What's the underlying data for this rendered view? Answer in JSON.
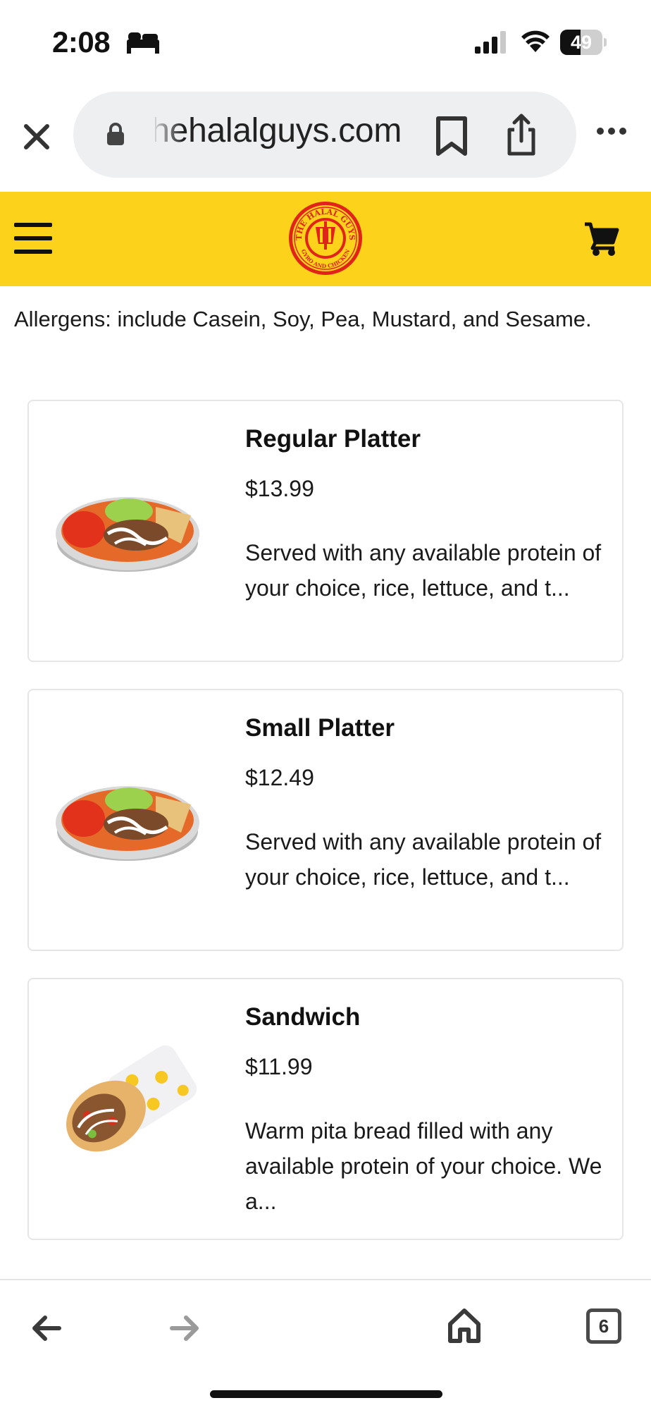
{
  "status_bar": {
    "time": "2:08",
    "battery_level": "49",
    "icons": [
      "bed-icon",
      "signal-icon",
      "wifi-icon",
      "battery-icon"
    ]
  },
  "browser": {
    "url": "thehalalguys.com",
    "icons": [
      "close-icon",
      "lock-icon",
      "bookmark-icon",
      "share-icon",
      "more-icon"
    ]
  },
  "site_header": {
    "logo_text_top": "THE HALAL GUYS",
    "logo_text_bottom": "GYRO AND CHICKEN",
    "brand_color": "#fcd21a",
    "logo_color": "#e2231a",
    "icons": [
      "hamburger-menu-icon",
      "cart-icon"
    ]
  },
  "allergens": "Allergens: include Casein, Soy, Pea, Mustard, and Sesame.",
  "menu_items": [
    {
      "name": "Regular Platter",
      "price": "$13.99",
      "description": "Served with any available protein of your choice, rice, lettuce, and t...",
      "image": "platter-image"
    },
    {
      "name": "Small Platter",
      "price": "$12.49",
      "description": "Served with any available protein of your choice, rice, lettuce, and t...",
      "image": "platter-image"
    },
    {
      "name": "Sandwich",
      "price": "$11.99",
      "description": "Warm pita bread filled with any available protein of your choice. We a...",
      "image": "sandwich-image"
    }
  ],
  "bottom_toolbar": {
    "tab_count": "6",
    "icons": [
      "back-arrow-icon",
      "forward-arrow-icon",
      "home-icon",
      "tabs-icon"
    ]
  }
}
